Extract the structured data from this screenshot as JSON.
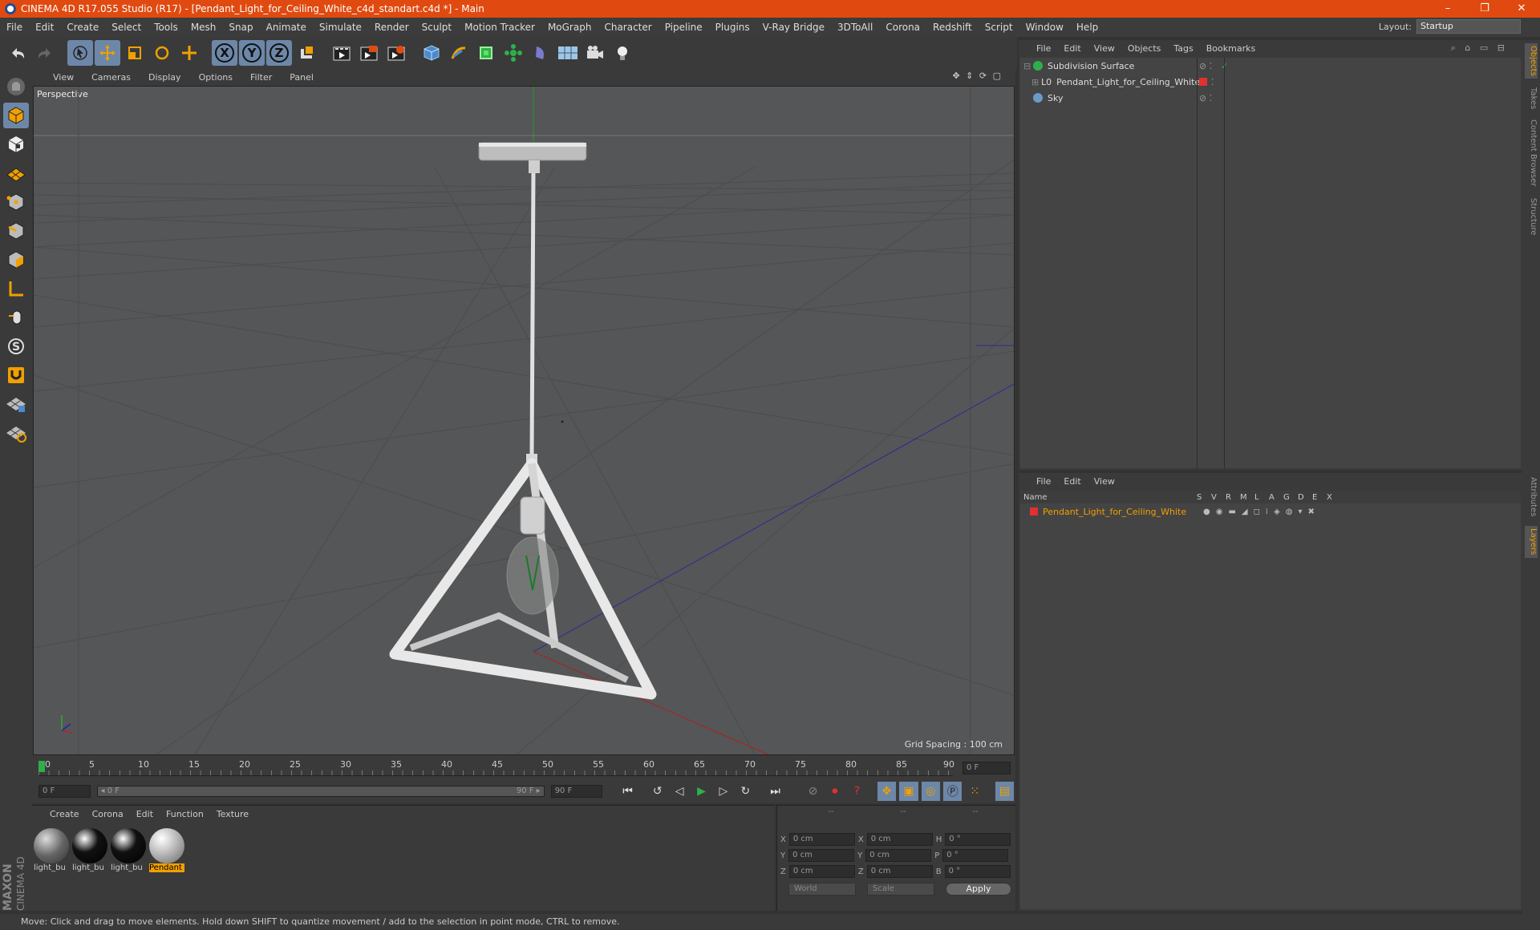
{
  "window": {
    "title": "CINEMA 4D R17.055 Studio (R17) - [Pendant_Light_for_Ceiling_White_c4d_standart.c4d *] - Main",
    "minimize": "–",
    "restore": "❐",
    "close": "✕"
  },
  "menu": [
    "File",
    "Edit",
    "Create",
    "Select",
    "Tools",
    "Mesh",
    "Snap",
    "Animate",
    "Simulate",
    "Render",
    "Sculpt",
    "Motion Tracker",
    "MoGraph",
    "Character",
    "Pipeline",
    "Plugins",
    "V-Ray Bridge",
    "3DToAll",
    "Corona",
    "Redshift",
    "Script",
    "Window",
    "Help"
  ],
  "layout": {
    "label": "Layout:",
    "value": "Startup"
  },
  "toolbar": {
    "icons": [
      "undo-icon",
      "redo-icon",
      "select-arrow-icon",
      "move-icon",
      "scale-icon",
      "rotate-icon",
      "transform-icon",
      "x-axis-icon",
      "y-axis-icon",
      "z-axis-icon",
      "coordinate-system-icon",
      "render-view-icon",
      "render-picture-viewer-icon",
      "render-settings-icon",
      "cube-icon",
      "pen-icon",
      "subdivision-icon",
      "array-icon",
      "deformer-icon",
      "floor-icon",
      "camera-icon",
      "light-icon"
    ],
    "axis_labels": [
      "X",
      "Y",
      "Z"
    ]
  },
  "viewport": {
    "menu": [
      "View",
      "Cameras",
      "Display",
      "Options",
      "Filter",
      "Panel"
    ],
    "label": "Perspective",
    "grid_spacing": "Grid Spacing : 100 cm"
  },
  "timeline": {
    "ticks": [
      "0",
      "5",
      "10",
      "15",
      "20",
      "25",
      "30",
      "35",
      "40",
      "45",
      "50",
      "55",
      "60",
      "65",
      "70",
      "75",
      "80",
      "85",
      "90"
    ],
    "current_frame": "0 F"
  },
  "transport": {
    "start": "0 F",
    "range_start": "◂ 0 F",
    "range_end": "90 F ▸",
    "end": "90 F"
  },
  "materials": {
    "menu": [
      "Create",
      "Corona",
      "Edit",
      "Function",
      "Texture"
    ],
    "items": [
      {
        "name": "light_bu"
      },
      {
        "name": "light_bu"
      },
      {
        "name": "light_bu"
      },
      {
        "name": "Pendant"
      }
    ]
  },
  "coords": {
    "headers": [
      "--",
      "--",
      "--"
    ],
    "rows": [
      {
        "a": "X",
        "av": "0 cm",
        "b": "X",
        "bv": "0 cm",
        "c": "H",
        "cv": "0 °"
      },
      {
        "a": "Y",
        "av": "0 cm",
        "b": "Y",
        "bv": "0 cm",
        "c": "P",
        "cv": "0 °"
      },
      {
        "a": "Z",
        "av": "0 cm",
        "b": "Z",
        "bv": "0 cm",
        "c": "B",
        "cv": "0 °"
      }
    ],
    "world": "World",
    "scale": "Scale",
    "apply": "Apply"
  },
  "object_manager": {
    "menu": [
      "File",
      "Edit",
      "View",
      "Objects",
      "Tags",
      "Bookmarks"
    ],
    "objects": [
      {
        "name": "Subdivision Surface"
      },
      {
        "name": "Pendant_Light_for_Ceiling_White"
      },
      {
        "name": "Sky"
      }
    ]
  },
  "layer_manager": {
    "menu": [
      "File",
      "Edit",
      "View"
    ],
    "header_name": "Name",
    "columns": [
      "S",
      "V",
      "R",
      "M",
      "L",
      "A",
      "G",
      "D",
      "E",
      "X"
    ],
    "layers": [
      {
        "name": "Pendant_Light_for_Ceiling_White",
        "color": "#e03030"
      }
    ]
  },
  "right_tabs": [
    "Objects",
    "Takes",
    "Content Browser",
    "Structure",
    "Attributes",
    "Layers"
  ],
  "status": "Move: Click and drag to move elements. Hold down SHIFT to quantize movement / add to the selection in point mode, CTRL to remove.",
  "brand": [
    "MAXON",
    "CINEMA 4D"
  ],
  "colors": {
    "title_bar": "#e04a10",
    "accent": "#f0a000",
    "highlight": "#6d87a8"
  }
}
